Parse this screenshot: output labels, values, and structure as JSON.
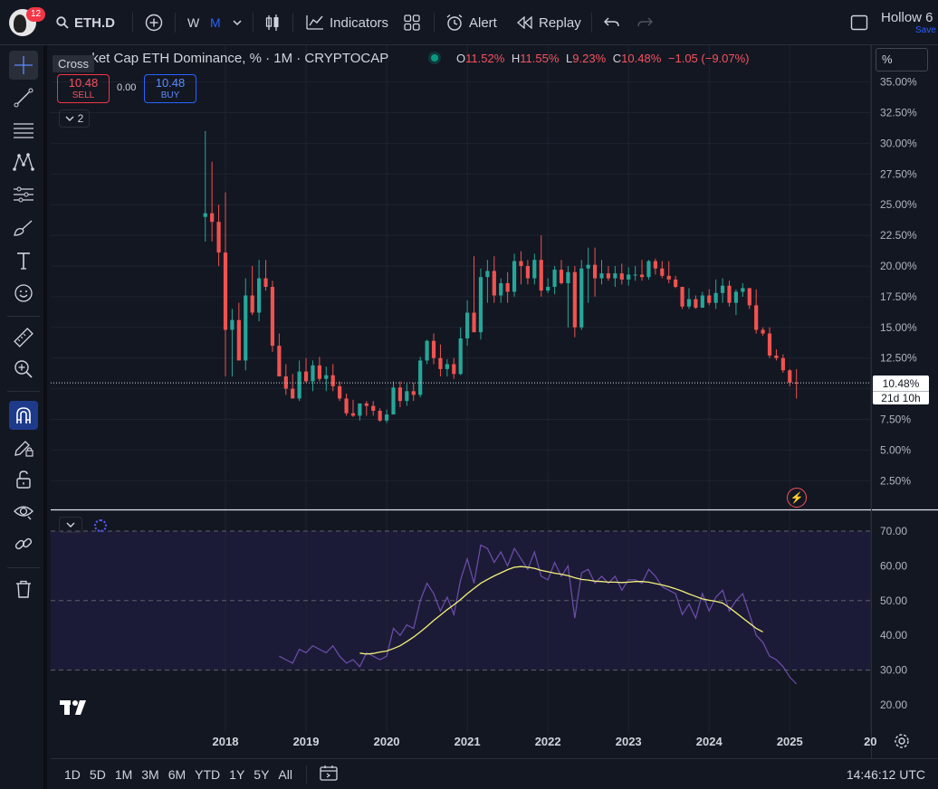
{
  "topbar": {
    "notification_count": "12",
    "symbol": "ETH.D",
    "intervals": [
      "W",
      "M"
    ],
    "indicators_label": "Indicators",
    "alert_label": "Alert",
    "replay_label": "Replay",
    "layout_name": "Hollow 6",
    "save_label": "Save"
  },
  "sidebar": {
    "tooltip": "Cross"
  },
  "legend": {
    "title": "Market Cap ETH Dominance, % · 1M · CRYPTOCAP",
    "title_visible": "arket Cap ETH Dominance, % · 1M · CRYPTOCAP",
    "o_key": "O",
    "o_val": "11.52%",
    "h_key": "H",
    "h_val": "11.55%",
    "l_key": "L",
    "l_val": "9.23%",
    "c_key": "C",
    "c_val": "10.48%",
    "change": "−1.05 (−9.07%)"
  },
  "trade": {
    "sell_price": "10.48",
    "sell_label": "SELL",
    "spread": "0.00",
    "buy_price": "10.48",
    "buy_label": "BUY"
  },
  "collapse_count": "2",
  "scale_unit": "%",
  "price_label": {
    "value": "10.48%",
    "countdown": "21d 10h"
  },
  "price_axis_ticks": [
    "35.00%",
    "32.50%",
    "30.00%",
    "27.50%",
    "25.00%",
    "22.50%",
    "20.00%",
    "17.50%",
    "15.00%",
    "12.50%",
    "7.50%",
    "5.00%",
    "2.50%"
  ],
  "rsi_axis_ticks": [
    "70.00",
    "60.00",
    "50.00",
    "40.00",
    "30.00",
    "20.00"
  ],
  "time_axis_ticks": [
    "2018",
    "2019",
    "2020",
    "2021",
    "2022",
    "2023",
    "2024",
    "2025",
    "20"
  ],
  "bottombar": {
    "ranges": [
      "1D",
      "5D",
      "1M",
      "3M",
      "6M",
      "YTD",
      "1Y",
      "5Y",
      "All"
    ],
    "clock": "14:46:12 UTC"
  },
  "colors": {
    "up": "#26a69a",
    "down": "#ef5350",
    "background": "#131722",
    "rsi_line": "#7e57c2",
    "rsi_ma": "#f5f07a"
  },
  "chart_data": [
    {
      "type": "candlestick",
      "title": "Market Cap ETH Dominance, % · 1M · CRYPTOCAP",
      "x": [
        "2017-10",
        "2017-11",
        "2017-12",
        "2018-01",
        "2018-02",
        "2018-03",
        "2018-04",
        "2018-05",
        "2018-06",
        "2018-07",
        "2018-08",
        "2018-09",
        "2018-10",
        "2018-11",
        "2018-12",
        "2019-01",
        "2019-02",
        "2019-03",
        "2019-04",
        "2019-05",
        "2019-06",
        "2019-07",
        "2019-08",
        "2019-09",
        "2019-10",
        "2019-11",
        "2019-12",
        "2020-01",
        "2020-02",
        "2020-03",
        "2020-04",
        "2020-05",
        "2020-06",
        "2020-07",
        "2020-08",
        "2020-09",
        "2020-10",
        "2020-11",
        "2020-12",
        "2021-01",
        "2021-02",
        "2021-03",
        "2021-04",
        "2021-05",
        "2021-06",
        "2021-07",
        "2021-08",
        "2021-09",
        "2021-10",
        "2021-11",
        "2021-12",
        "2022-01",
        "2022-02",
        "2022-03",
        "2022-04",
        "2022-05",
        "2022-06",
        "2022-07",
        "2022-08",
        "2022-09",
        "2022-10",
        "2022-11",
        "2022-12",
        "2023-01",
        "2023-02",
        "2023-03",
        "2023-04",
        "2023-05",
        "2023-06",
        "2023-07",
        "2023-08",
        "2023-09",
        "2023-10",
        "2023-11",
        "2023-12",
        "2024-01",
        "2024-02",
        "2024-03",
        "2024-04",
        "2024-05",
        "2024-06",
        "2024-07",
        "2024-08",
        "2024-09",
        "2024-10",
        "2024-11",
        "2024-12",
        "2025-01",
        "2025-02"
      ],
      "open": [
        24.0,
        24.3,
        23.6,
        21.1,
        14.8,
        15.6,
        12.3,
        17.6,
        16.2,
        19.0,
        18.3,
        13.5,
        11.0,
        10.0,
        9.2,
        11.4,
        10.6,
        11.9,
        10.8,
        11.1,
        10.2,
        9.2,
        8.0,
        7.8,
        8.8,
        8.6,
        8.2,
        7.4,
        7.9,
        10.1,
        9.0,
        9.8,
        9.5,
        12.3,
        13.9,
        12.5,
        11.6,
        12.0,
        11.2,
        14.1,
        16.2,
        14.6,
        19.1,
        19.6,
        17.6,
        18.6,
        17.9,
        20.4,
        20.0,
        19.0,
        20.5,
        18.0,
        18.3,
        19.7,
        18.6,
        19.5,
        15.0,
        19.8,
        20.1,
        19.0,
        19.4,
        19.0,
        19.4,
        18.9,
        19.3,
        19.3,
        19.1,
        20.4,
        19.8,
        19.2,
        18.9,
        18.3,
        16.7,
        17.3,
        16.6,
        17.6,
        17.0,
        17.8,
        18.4,
        17.0,
        17.9,
        18.2,
        16.8,
        14.8,
        14.5,
        12.7,
        12.5,
        11.5,
        10.5
      ],
      "high": [
        31.0,
        28.5,
        25.0,
        26.0,
        16.5,
        17.0,
        19.0,
        20.0,
        20.5,
        20.5,
        18.8,
        14.5,
        12.0,
        11.2,
        12.3,
        12.5,
        12.3,
        12.6,
        11.8,
        12.0,
        10.6,
        9.6,
        9.1,
        8.3,
        9.0,
        9.0,
        8.4,
        8.3,
        10.6,
        10.6,
        10.4,
        10.5,
        12.6,
        14.0,
        14.5,
        13.6,
        12.4,
        12.5,
        15.0,
        17.2,
        20.8,
        19.8,
        20.5,
        20.8,
        19.0,
        19.5,
        21.0,
        21.2,
        20.5,
        21.0,
        22.5,
        19.0,
        20.0,
        20.5,
        20.0,
        20.0,
        20.5,
        21.5,
        21.5,
        20.5,
        20.0,
        20.0,
        20.2,
        19.9,
        20.0,
        20.5,
        20.5,
        20.6,
        20.4,
        20.4,
        19.2,
        18.3,
        18.2,
        17.6,
        17.9,
        18.1,
        18.9,
        19.0,
        18.8,
        18.1,
        18.6,
        18.2,
        18.1,
        15.0,
        15.0,
        13.2,
        12.8,
        11.6,
        11.6
      ],
      "low": [
        22.0,
        22.0,
        20.0,
        11.0,
        11.0,
        14.5,
        11.5,
        16.0,
        15.5,
        18.0,
        13.0,
        11.0,
        9.5,
        9.3,
        9.0,
        10.5,
        9.8,
        10.6,
        9.8,
        9.8,
        9.0,
        7.8,
        7.7,
        7.4,
        7.8,
        7.8,
        7.3,
        7.2,
        7.9,
        8.5,
        8.6,
        9.0,
        9.3,
        12.0,
        12.0,
        11.0,
        11.0,
        10.8,
        11.1,
        13.5,
        15.0,
        14.0,
        17.0,
        17.0,
        17.0,
        17.0,
        17.5,
        18.5,
        18.5,
        18.5,
        17.5,
        17.8,
        17.7,
        18.5,
        15.0,
        14.2,
        14.8,
        17.0,
        17.5,
        18.5,
        18.8,
        18.3,
        18.5,
        18.4,
        18.8,
        18.8,
        18.9,
        19.3,
        19.0,
        18.6,
        18.2,
        16.5,
        16.5,
        16.5,
        16.6,
        16.8,
        16.5,
        17.0,
        16.7,
        16.0,
        17.5,
        16.5,
        14.5,
        14.3,
        12.5,
        12.3,
        11.3,
        10.2,
        9.2
      ],
      "close": [
        24.3,
        23.6,
        21.1,
        14.8,
        15.6,
        12.3,
        17.6,
        16.2,
        19.0,
        18.3,
        13.5,
        11.0,
        10.0,
        9.2,
        11.4,
        10.6,
        11.9,
        10.8,
        11.1,
        10.2,
        9.2,
        8.0,
        7.8,
        8.8,
        8.6,
        8.2,
        7.4,
        7.9,
        10.1,
        9.0,
        9.8,
        9.5,
        12.3,
        13.9,
        12.5,
        11.6,
        12.0,
        11.2,
        14.1,
        16.2,
        14.6,
        19.1,
        19.6,
        17.6,
        18.6,
        17.9,
        20.4,
        20.0,
        19.0,
        20.5,
        18.0,
        18.3,
        19.7,
        18.6,
        19.5,
        15.0,
        19.8,
        20.1,
        19.0,
        19.4,
        19.0,
        19.4,
        18.9,
        19.3,
        19.3,
        19.1,
        20.4,
        19.8,
        19.2,
        18.9,
        18.3,
        16.7,
        17.3,
        16.6,
        17.6,
        17.0,
        17.8,
        18.4,
        17.0,
        17.9,
        18.2,
        16.8,
        14.8,
        14.5,
        12.7,
        12.5,
        11.5,
        10.5,
        10.48
      ],
      "ylim": [
        0,
        36.5
      ]
    },
    {
      "type": "line",
      "series": [
        {
          "values": [
            null,
            null,
            null,
            null,
            null,
            null,
            null,
            null,
            null,
            null,
            null,
            34,
            33,
            32,
            36,
            35,
            37,
            36,
            35,
            37,
            34,
            32,
            33,
            31,
            35,
            34,
            33,
            34,
            42,
            40,
            43,
            42,
            50,
            55,
            52,
            47,
            51,
            46,
            56,
            62,
            55,
            66,
            65,
            61,
            64,
            60,
            65,
            62,
            59,
            64,
            57,
            56,
            61,
            57,
            60,
            45,
            58,
            59,
            55,
            57,
            55,
            57,
            53,
            56,
            56,
            55,
            59,
            57,
            54,
            53,
            52,
            46,
            49,
            45,
            52,
            47,
            51,
            53,
            47,
            50,
            52,
            46,
            40,
            38,
            34,
            33,
            31,
            28,
            26
          ]
        },
        {
          "values": [
            null,
            null,
            null,
            null,
            null,
            null,
            null,
            null,
            null,
            null,
            null,
            null,
            null,
            null,
            null,
            null,
            null,
            null,
            null,
            null,
            null,
            null,
            null,
            34.9,
            34.6,
            34.8,
            35.2,
            35.5,
            36.2,
            37.0,
            38.2,
            39.5,
            41.0,
            42.6,
            44.3,
            45.8,
            47.4,
            48.8,
            50.3,
            52.0,
            53.5,
            55.0,
            56.1,
            57.1,
            58.0,
            58.9,
            59.6,
            59.8,
            59.6,
            59.3,
            58.7,
            58.3,
            57.9,
            57.6,
            57.2,
            56.6,
            56.1,
            55.9,
            55.6,
            55.5,
            55.3,
            55.3,
            55.2,
            55.3,
            55.5,
            55.5,
            55.3,
            54.9,
            54.5,
            54.0,
            53.4,
            52.7,
            51.9,
            51.2,
            50.5,
            50.1,
            49.8,
            49.3,
            48.0,
            46.5,
            45.0,
            43.5,
            42.0,
            41.0
          ]
        }
      ],
      "ylim": [
        15,
        75
      ]
    }
  ]
}
